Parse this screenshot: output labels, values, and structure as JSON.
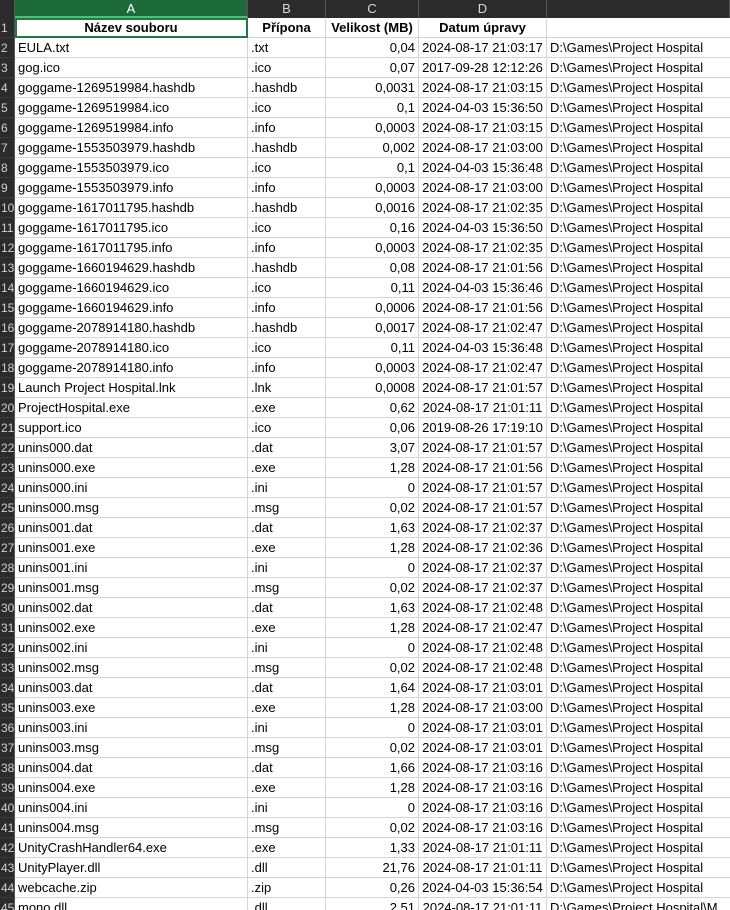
{
  "columns": [
    "A",
    "B",
    "C",
    "D"
  ],
  "header": {
    "row_number": "1",
    "name": "Název souboru",
    "ext": "Přípona",
    "size": "Velikost (MB)",
    "date": "Datum úpravy",
    "path": ""
  },
  "rows": [
    {
      "n": "2",
      "name": "EULA.txt",
      "ext": ".txt",
      "size": "0,04",
      "date": "2024-08-17 21:03:17",
      "path": "D:\\Games\\Project Hospital"
    },
    {
      "n": "3",
      "name": "gog.ico",
      "ext": ".ico",
      "size": "0,07",
      "date": "2017-09-28 12:12:26",
      "path": "D:\\Games\\Project Hospital"
    },
    {
      "n": "4",
      "name": "goggame-1269519984.hashdb",
      "ext": ".hashdb",
      "size": "0,0031",
      "date": "2024-08-17 21:03:15",
      "path": "D:\\Games\\Project Hospital"
    },
    {
      "n": "5",
      "name": "goggame-1269519984.ico",
      "ext": ".ico",
      "size": "0,1",
      "date": "2024-04-03 15:36:50",
      "path": "D:\\Games\\Project Hospital"
    },
    {
      "n": "6",
      "name": "goggame-1269519984.info",
      "ext": ".info",
      "size": "0,0003",
      "date": "2024-08-17 21:03:15",
      "path": "D:\\Games\\Project Hospital"
    },
    {
      "n": "7",
      "name": "goggame-1553503979.hashdb",
      "ext": ".hashdb",
      "size": "0,002",
      "date": "2024-08-17 21:03:00",
      "path": "D:\\Games\\Project Hospital"
    },
    {
      "n": "8",
      "name": "goggame-1553503979.ico",
      "ext": ".ico",
      "size": "0,1",
      "date": "2024-04-03 15:36:48",
      "path": "D:\\Games\\Project Hospital"
    },
    {
      "n": "9",
      "name": "goggame-1553503979.info",
      "ext": ".info",
      "size": "0,0003",
      "date": "2024-08-17 21:03:00",
      "path": "D:\\Games\\Project Hospital"
    },
    {
      "n": "10",
      "name": "goggame-1617011795.hashdb",
      "ext": ".hashdb",
      "size": "0,0016",
      "date": "2024-08-17 21:02:35",
      "path": "D:\\Games\\Project Hospital"
    },
    {
      "n": "11",
      "name": "goggame-1617011795.ico",
      "ext": ".ico",
      "size": "0,16",
      "date": "2024-04-03 15:36:50",
      "path": "D:\\Games\\Project Hospital"
    },
    {
      "n": "12",
      "name": "goggame-1617011795.info",
      "ext": ".info",
      "size": "0,0003",
      "date": "2024-08-17 21:02:35",
      "path": "D:\\Games\\Project Hospital"
    },
    {
      "n": "13",
      "name": "goggame-1660194629.hashdb",
      "ext": ".hashdb",
      "size": "0,08",
      "date": "2024-08-17 21:01:56",
      "path": "D:\\Games\\Project Hospital"
    },
    {
      "n": "14",
      "name": "goggame-1660194629.ico",
      "ext": ".ico",
      "size": "0,11",
      "date": "2024-04-03 15:36:46",
      "path": "D:\\Games\\Project Hospital"
    },
    {
      "n": "15",
      "name": "goggame-1660194629.info",
      "ext": ".info",
      "size": "0,0006",
      "date": "2024-08-17 21:01:56",
      "path": "D:\\Games\\Project Hospital"
    },
    {
      "n": "16",
      "name": "goggame-2078914180.hashdb",
      "ext": ".hashdb",
      "size": "0,0017",
      "date": "2024-08-17 21:02:47",
      "path": "D:\\Games\\Project Hospital"
    },
    {
      "n": "17",
      "name": "goggame-2078914180.ico",
      "ext": ".ico",
      "size": "0,11",
      "date": "2024-04-03 15:36:48",
      "path": "D:\\Games\\Project Hospital"
    },
    {
      "n": "18",
      "name": "goggame-2078914180.info",
      "ext": ".info",
      "size": "0,0003",
      "date": "2024-08-17 21:02:47",
      "path": "D:\\Games\\Project Hospital"
    },
    {
      "n": "19",
      "name": "Launch Project Hospital.lnk",
      "ext": ".lnk",
      "size": "0,0008",
      "date": "2024-08-17 21:01:57",
      "path": "D:\\Games\\Project Hospital"
    },
    {
      "n": "20",
      "name": "ProjectHospital.exe",
      "ext": ".exe",
      "size": "0,62",
      "date": "2024-08-17 21:01:11",
      "path": "D:\\Games\\Project Hospital"
    },
    {
      "n": "21",
      "name": "support.ico",
      "ext": ".ico",
      "size": "0,06",
      "date": "2019-08-26 17:19:10",
      "path": "D:\\Games\\Project Hospital"
    },
    {
      "n": "22",
      "name": "unins000.dat",
      "ext": ".dat",
      "size": "3,07",
      "date": "2024-08-17 21:01:57",
      "path": "D:\\Games\\Project Hospital"
    },
    {
      "n": "23",
      "name": "unins000.exe",
      "ext": ".exe",
      "size": "1,28",
      "date": "2024-08-17 21:01:56",
      "path": "D:\\Games\\Project Hospital"
    },
    {
      "n": "24",
      "name": "unins000.ini",
      "ext": ".ini",
      "size": "0",
      "date": "2024-08-17 21:01:57",
      "path": "D:\\Games\\Project Hospital"
    },
    {
      "n": "25",
      "name": "unins000.msg",
      "ext": ".msg",
      "size": "0,02",
      "date": "2024-08-17 21:01:57",
      "path": "D:\\Games\\Project Hospital"
    },
    {
      "n": "26",
      "name": "unins001.dat",
      "ext": ".dat",
      "size": "1,63",
      "date": "2024-08-17 21:02:37",
      "path": "D:\\Games\\Project Hospital"
    },
    {
      "n": "27",
      "name": "unins001.exe",
      "ext": ".exe",
      "size": "1,28",
      "date": "2024-08-17 21:02:36",
      "path": "D:\\Games\\Project Hospital"
    },
    {
      "n": "28",
      "name": "unins001.ini",
      "ext": ".ini",
      "size": "0",
      "date": "2024-08-17 21:02:37",
      "path": "D:\\Games\\Project Hospital"
    },
    {
      "n": "29",
      "name": "unins001.msg",
      "ext": ".msg",
      "size": "0,02",
      "date": "2024-08-17 21:02:37",
      "path": "D:\\Games\\Project Hospital"
    },
    {
      "n": "30",
      "name": "unins002.dat",
      "ext": ".dat",
      "size": "1,63",
      "date": "2024-08-17 21:02:48",
      "path": "D:\\Games\\Project Hospital"
    },
    {
      "n": "31",
      "name": "unins002.exe",
      "ext": ".exe",
      "size": "1,28",
      "date": "2024-08-17 21:02:47",
      "path": "D:\\Games\\Project Hospital"
    },
    {
      "n": "32",
      "name": "unins002.ini",
      "ext": ".ini",
      "size": "0",
      "date": "2024-08-17 21:02:48",
      "path": "D:\\Games\\Project Hospital"
    },
    {
      "n": "33",
      "name": "unins002.msg",
      "ext": ".msg",
      "size": "0,02",
      "date": "2024-08-17 21:02:48",
      "path": "D:\\Games\\Project Hospital"
    },
    {
      "n": "34",
      "name": "unins003.dat",
      "ext": ".dat",
      "size": "1,64",
      "date": "2024-08-17 21:03:01",
      "path": "D:\\Games\\Project Hospital"
    },
    {
      "n": "35",
      "name": "unins003.exe",
      "ext": ".exe",
      "size": "1,28",
      "date": "2024-08-17 21:03:00",
      "path": "D:\\Games\\Project Hospital"
    },
    {
      "n": "36",
      "name": "unins003.ini",
      "ext": ".ini",
      "size": "0",
      "date": "2024-08-17 21:03:01",
      "path": "D:\\Games\\Project Hospital"
    },
    {
      "n": "37",
      "name": "unins003.msg",
      "ext": ".msg",
      "size": "0,02",
      "date": "2024-08-17 21:03:01",
      "path": "D:\\Games\\Project Hospital"
    },
    {
      "n": "38",
      "name": "unins004.dat",
      "ext": ".dat",
      "size": "1,66",
      "date": "2024-08-17 21:03:16",
      "path": "D:\\Games\\Project Hospital"
    },
    {
      "n": "39",
      "name": "unins004.exe",
      "ext": ".exe",
      "size": "1,28",
      "date": "2024-08-17 21:03:16",
      "path": "D:\\Games\\Project Hospital"
    },
    {
      "n": "40",
      "name": "unins004.ini",
      "ext": ".ini",
      "size": "0",
      "date": "2024-08-17 21:03:16",
      "path": "D:\\Games\\Project Hospital"
    },
    {
      "n": "41",
      "name": "unins004.msg",
      "ext": ".msg",
      "size": "0,02",
      "date": "2024-08-17 21:03:16",
      "path": "D:\\Games\\Project Hospital"
    },
    {
      "n": "42",
      "name": "UnityCrashHandler64.exe",
      "ext": ".exe",
      "size": "1,33",
      "date": "2024-08-17 21:01:11",
      "path": "D:\\Games\\Project Hospital"
    },
    {
      "n": "43",
      "name": "UnityPlayer.dll",
      "ext": ".dll",
      "size": "21,76",
      "date": "2024-08-17 21:01:11",
      "path": "D:\\Games\\Project Hospital"
    },
    {
      "n": "44",
      "name": "webcache.zip",
      "ext": ".zip",
      "size": "0,26",
      "date": "2024-04-03 15:36:54",
      "path": "D:\\Games\\Project Hospital"
    },
    {
      "n": "45",
      "name": "mono.dll",
      "ext": ".dll",
      "size": "2,51",
      "date": "2024-08-17 21:01:11",
      "path": "D:\\Games\\Project Hospital\\M"
    }
  ],
  "colors": {
    "header_bg": "#2b2b2b",
    "selected_col_bg": "#1e6b3a",
    "grid_line": "#d4d4d4"
  }
}
